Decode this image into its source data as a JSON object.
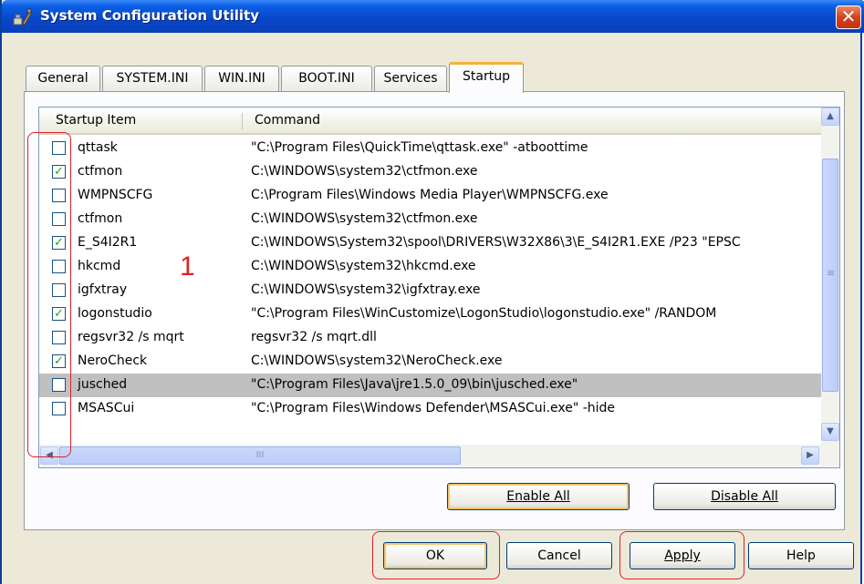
{
  "window": {
    "title": "System Configuration Utility",
    "close_glyph": "✕"
  },
  "tabs": [
    {
      "label": "General"
    },
    {
      "label": "SYSTEM.INI"
    },
    {
      "label": "WIN.INI"
    },
    {
      "label": "BOOT.INI"
    },
    {
      "label": "Services"
    },
    {
      "label": "Startup",
      "active": true
    }
  ],
  "list": {
    "columns": [
      "Startup Item",
      "Command"
    ],
    "rows": [
      {
        "name": "qttask",
        "command": "\"C:\\Program Files\\QuickTime\\qttask.exe\" -atboottime",
        "checked": false,
        "check_glyph": ""
      },
      {
        "name": "ctfmon",
        "command": "C:\\WINDOWS\\system32\\ctfmon.exe",
        "checked": true,
        "check_glyph": "✓"
      },
      {
        "name": "WMPNSCFG",
        "command": "C:\\Program Files\\Windows Media Player\\WMPNSCFG.exe",
        "checked": false,
        "check_glyph": ""
      },
      {
        "name": "ctfmon",
        "command": "C:\\WINDOWS\\system32\\ctfmon.exe",
        "checked": false,
        "check_glyph": ""
      },
      {
        "name": "E_S4I2R1",
        "command": "C:\\WINDOWS\\System32\\spool\\DRIVERS\\W32X86\\3\\E_S4I2R1.EXE /P23 \"EPSC",
        "checked": true,
        "check_glyph": "✓"
      },
      {
        "name": "hkcmd",
        "command": "C:\\WINDOWS\\system32\\hkcmd.exe",
        "checked": false,
        "check_glyph": ""
      },
      {
        "name": "igfxtray",
        "command": "C:\\WINDOWS\\system32\\igfxtray.exe",
        "checked": false,
        "check_glyph": ""
      },
      {
        "name": "logonstudio",
        "command": "\"C:\\Program Files\\WinCustomize\\LogonStudio\\logonstudio.exe\" /RANDOM",
        "checked": true,
        "check_glyph": "✓"
      },
      {
        "name": "regsvr32 /s mqrt",
        "command": "regsvr32 /s mqrt.dll",
        "checked": false,
        "check_glyph": ""
      },
      {
        "name": "NeroCheck",
        "command": "C:\\WINDOWS\\system32\\NeroCheck.exe",
        "checked": true,
        "check_glyph": "✓"
      },
      {
        "name": "jusched",
        "command": "\"C:\\Program Files\\Java\\jre1.5.0_09\\bin\\jusched.exe\"",
        "checked": false,
        "check_glyph": "",
        "selected": true
      },
      {
        "name": "MSASCui",
        "command": "\"C:\\Program Files\\Windows Defender\\MSASCui.exe\" -hide",
        "checked": false,
        "check_glyph": ""
      }
    ]
  },
  "scroll": {
    "up": "▲",
    "down": "▼",
    "left": "◀",
    "right": "▶",
    "grip_v": "≡",
    "grip_h": "III"
  },
  "buttons": {
    "enable_all": "Enable All",
    "disable_all": "Disable All",
    "ok": "OK",
    "cancel": "Cancel",
    "apply": "Apply",
    "help": "Help"
  },
  "annotation": {
    "label": "1",
    "color": "#e0202a"
  }
}
